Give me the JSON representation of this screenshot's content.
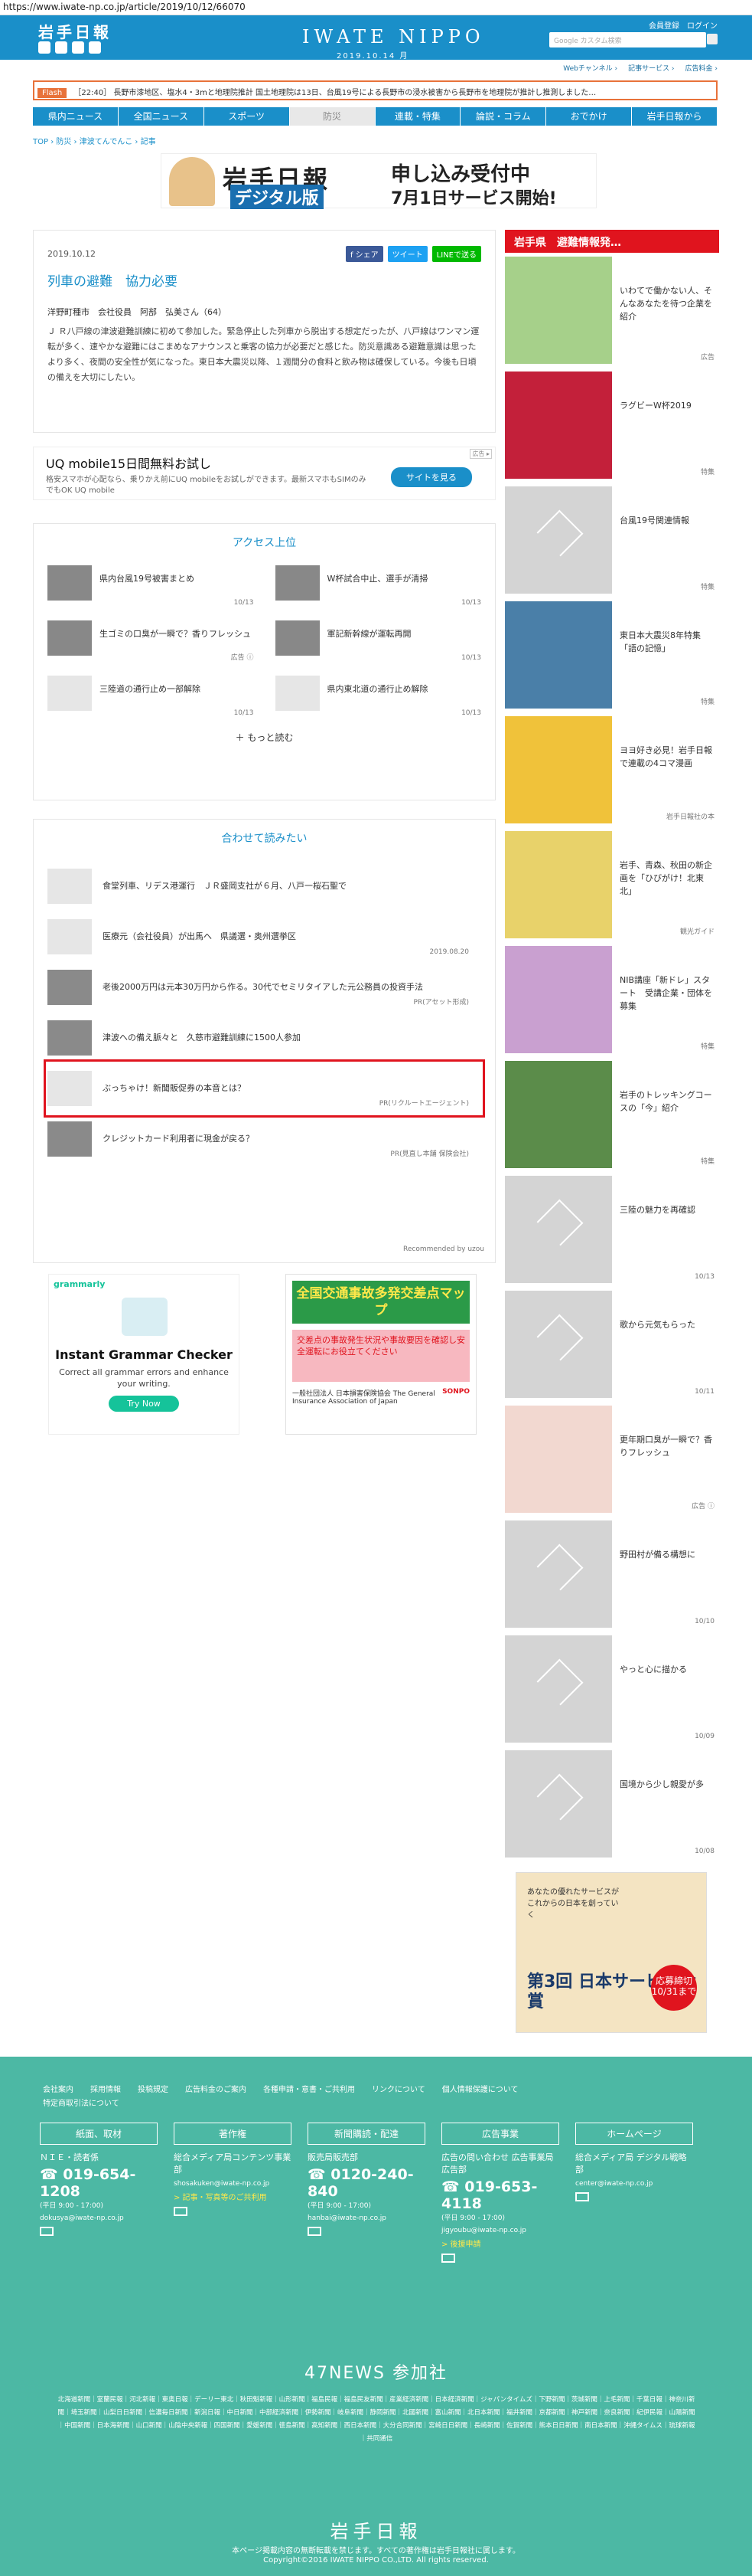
{
  "browser": {
    "url": "https://www.iwate-np.co.jp/article/2019/10/12/66070"
  },
  "header": {
    "logo": "岩手日報",
    "brand": "IWATE NIPPO",
    "date": "2019.10.14 月",
    "links": [
      "会員登録",
      "ログイン"
    ],
    "search_placeholder": "Google カスタム検索",
    "sub_links": [
      "Webチャンネル ›",
      "記事サービス ›",
      "広告料金 ›"
    ]
  },
  "flash": {
    "tag": "Flash",
    "text": "［22:40］ 長野市漆地区、塩水4・3mと地理院推計 国土地理院は13日、台風19号による長野市の浸水被害から長野市を地理院が推計し推測しました…"
  },
  "nav": [
    "県内ニュース",
    "全国ニュース",
    "スポーツ",
    "防災",
    "連載・特集",
    "論説・コラム",
    "おでかけ",
    "岩手日報から"
  ],
  "breadcrumb": [
    "TOP",
    "防災",
    "津波てんでんこ",
    "記事"
  ],
  "banner": {
    "logo": "岩手日報",
    "edition": "デジタル版",
    "headline": "申し込み受付中",
    "sub": "7月1日サービス開始!"
  },
  "article": {
    "date": "2019.10.12",
    "share": [
      "f シェア",
      "ツイート",
      "LINEで送る"
    ],
    "title": "列車の避難　協力必要",
    "byline": "洋野町種市　会社役員　阿部　弘美さん（64）",
    "body": "Ｊ Ｒ八戸線の津波避難訓練に初めて参加した。緊急停止した列車から脱出する想定だったが、八戸線はワンマン運転が多く、速やかな避難にはこまめなアナウンスと乗客の協力が必要だと感じた。防災意識ある避難意識は思ったより多く、夜間の安全性が気になった。東日本大震災以降、１週間分の食料と飲み物は確保している。今後も日頃の備えを大切にしたい。"
  },
  "ad_uq": {
    "label": "広告 ▸",
    "title": "UQ mobile15日間無料お試し",
    "desc": "格安スマホが心配なら、乗りかえ前にUQ mobileをお試しができます。最新スマホもSIMのみでもOK UQ mobile",
    "button": "サイトを見る"
  },
  "access": {
    "title": "アクセス上位",
    "items": [
      {
        "text": "県内台風19号被害まとめ",
        "date": "10/13",
        "thumb": "photo"
      },
      {
        "text": "W杯試合中止、選手が清掃",
        "date": "10/13",
        "thumb": "photo"
      },
      {
        "text": "生ゴミの口臭が一瞬で？香りフレッシュ",
        "date": "広告 ⓘ",
        "thumb": "photo"
      },
      {
        "text": "軍記新幹線が運転再開",
        "date": "10/13",
        "thumb": "photo"
      },
      {
        "text": "三陸道の通行止め一部解除",
        "date": "10/13",
        "thumb": "ph"
      },
      {
        "text": "県内東北道の通行止め解除",
        "date": "10/13",
        "thumb": "ph"
      }
    ],
    "more": "もっと読む"
  },
  "related": {
    "title": "合わせて読みたい",
    "items": [
      {
        "text": "食堂列車、リデス港運行　ＪＲ盛岡支社が６月、八戸一桜石聖で",
        "small": "",
        "thumb": "ph"
      },
      {
        "text": "医療元（会社役員）が出馬へ　県議選・奥州選挙区",
        "small": "2019.08.20",
        "thumb": "ph"
      },
      {
        "text": "老後2000万円は元本30万円から作る。30代でセミリタイアした元公務員の投資手法",
        "small": "PR(アセット形成)",
        "thumb": "photo"
      },
      {
        "text": "津波への備え脈々と　久慈市避難訓練に1500人参加",
        "small": "",
        "thumb": "photo"
      },
      {
        "text": "ぶっちゃけ！新聞販促券の本音とは？",
        "small": "PR(リクルートエージェント)",
        "thumb": "ph"
      },
      {
        "text": "クレジットカード利用者に現金が戻る？",
        "small": "PR(見直し本舗 保険会社)",
        "thumb": "photo"
      }
    ],
    "footer": "Recommended by uzou"
  },
  "ads_bottom": {
    "ad_label": "広告 ▸",
    "grammarly": {
      "logo": "grammarly",
      "headline": "Instant Grammar Checker",
      "sub": "Correct all grammar errors and enhance your writing.",
      "button": "Try Now"
    },
    "traffic": {
      "headline": "全国交通事故多発交差点マップ",
      "mid": "交差点の事故発生状況や事故要因を確認し安全運転にお役立てください",
      "org": "一般社団法人 日本損害保険協会 The General Insurance Association of Japan",
      "sponsor": "SONPO"
    }
  },
  "sidebar": {
    "header": "岩手県　避難情報発…",
    "items": [
      {
        "text": "いわてで働かない人、そんなあなたを待つ企業を紹介",
        "small": "広告",
        "thumb": "photo"
      },
      {
        "text": "ラグビーW杯2019",
        "small": "特集",
        "thumb": "photo"
      },
      {
        "text": "台風19号関連情報",
        "small": "特集",
        "thumb": "ph"
      },
      {
        "text": "東日本大震災8年特集「語の記憶」",
        "small": "特集",
        "thumb": "photo"
      },
      {
        "text": "ヨヨ好き必見！岩手日報で連載の4コマ漫画",
        "small": "岩手日報社の本",
        "thumb": "photo"
      },
      {
        "text": "岩手、青森、秋田の新企画を「ひびがけ！北東北」",
        "small": "観光ガイド",
        "thumb": "photo"
      },
      {
        "text": "NIB講座「新ドレ」スタート　受講企業・団体を募集",
        "small": "特集",
        "thumb": "photo"
      },
      {
        "text": "岩手のトレッキングコースの「今」紹介",
        "small": "特集",
        "thumb": "photo"
      },
      {
        "text": "三陸の魅力を再確認",
        "small": "10/13",
        "thumb": "ph"
      },
      {
        "text": "歌から元気もらった",
        "small": "10/11",
        "thumb": "ph"
      },
      {
        "text": "更年期口臭が一瞬で？香りフレッシュ",
        "small": "広告 ⓘ",
        "thumb": "photo"
      },
      {
        "text": "野田村が備る構想に",
        "small": "10/10",
        "thumb": "ph"
      },
      {
        "text": "やっと心に描かる",
        "small": "10/09",
        "thumb": "ph"
      },
      {
        "text": "国境から少し親愛が多",
        "small": "10/08",
        "thumb": "ph"
      }
    ],
    "ad": {
      "text": "あなたの優れたサービスがこれからの日本を創っていく",
      "title": "第3回 日本サービス大賞",
      "badge": "応募締切 10/31まで"
    }
  },
  "footer": {
    "links": [
      "会社案内",
      "採用情報",
      "投稿規定",
      "広告料金のご案内",
      "各種申請・意書・ご共利用",
      "リンクについて",
      "個人情報保護について"
    ],
    "link2": "特定商取引法について",
    "cols": [
      {
        "head": "紙面、取材",
        "l1": "ＮＩＥ・読者係",
        "tel": "019-654-1208",
        "hours": "(平日 9:00 - 17:00)",
        "mail": "dokusya@iwate-np.co.jp",
        "ln": ""
      },
      {
        "head": "著作権",
        "l1": "総合メディア局コンテンツ事業部",
        "tel": "",
        "hours": "",
        "mail": "shosakuken@iwate-np.co.jp",
        "ln": "> 記事・写真等のご共利用"
      },
      {
        "head": "新聞購読・配達",
        "l1": "販売局販売部",
        "tel": "0120-240-840",
        "hours": "(平日 9:00 - 17:00)",
        "mail": "hanbai@iwate-np.co.jp",
        "ln": ""
      },
      {
        "head": "広告事業",
        "l1": "広告の問い合わせ 広告事業局広告部",
        "tel": "019-653-4118",
        "hours": "(平日 9:00 - 17:00)",
        "mail": "jigyoubu@iwate-np.co.jp",
        "ln": "> 後援申請"
      },
      {
        "head": "ホームページ",
        "l1": "総合メディア局 デジタル戦略部",
        "tel": "",
        "hours": "",
        "mail": "center@iwate-np.co.jp",
        "ln": ""
      }
    ],
    "news47": "47NEWS 参加社",
    "papers": "北海道新聞｜室蘭民報｜河北新報｜東奥日報｜デーリー東北｜秋田魁新報｜山形新聞｜福島民報｜福島民友新聞｜産業経済新聞｜日本経済新聞｜ジャパンタイムズ｜下野新聞｜茨城新聞｜上毛新聞｜千葉日報｜神奈川新聞｜埼玉新聞｜山梨日日新聞｜信濃毎日新聞｜新潟日報｜中日新聞｜中部経済新聞｜伊勢新聞｜岐阜新聞｜静岡新聞｜北國新聞｜富山新聞｜北日本新聞｜福井新聞｜京都新聞｜神戸新聞｜奈良新聞｜紀伊民報｜山陽新聞｜中国新聞｜日本海新聞｜山口新聞｜山陰中央新報｜四国新聞｜愛媛新聞｜徳島新聞｜高知新聞｜西日本新聞｜大分合同新聞｜宮崎日日新聞｜長崎新聞｜佐賀新聞｜熊本日日新聞｜南日本新聞｜沖縄タイムス｜琉球新報｜共同通信",
    "logo": "岩手日報",
    "note": "本ページ掲載内容の無断転載を禁じます。すべての著作権は岩手日報社に属します。",
    "copy": "Copyright©2016 IWATE NIPPO CO.,LTD. All rights reserved."
  }
}
